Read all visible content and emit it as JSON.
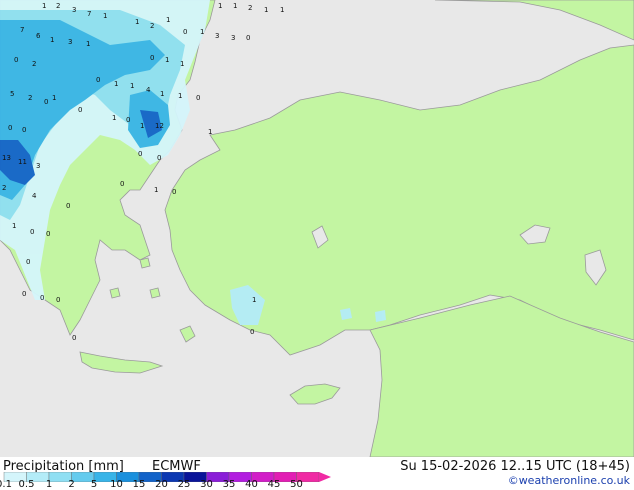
{
  "header": {
    "title": "Precipitation [mm]",
    "model": "ECMWF"
  },
  "timeline": "Su 15-02-2026 12..15 UTC (18+45)",
  "credit": "©weatheronline.co.uk",
  "colors": {
    "land": "#c3f5a2",
    "sea": "#e8e8e8",
    "border": "#9a9a9a"
  },
  "legend": {
    "ticks": [
      "0.1",
      "0.5",
      "1",
      "2",
      "5",
      "10",
      "15",
      "20",
      "25",
      "30",
      "35",
      "40",
      "45",
      "50"
    ],
    "colors": [
      "#d4f5fb",
      "#b4ecf8",
      "#8fdff3",
      "#64cbee",
      "#38b4e8",
      "#1a90dd",
      "#1263c9",
      "#0c38b2",
      "#0a1499",
      "#8a1ed8",
      "#b21de0",
      "#d21ec8",
      "#e21eb4",
      "#f02aa4"
    ]
  },
  "map_labels": [
    "1",
    "2",
    "3",
    "7",
    "1",
    "1",
    "1",
    "2",
    "1",
    "1",
    "7",
    "6",
    "1",
    "1",
    "2",
    "1",
    "1",
    "3",
    "3",
    "0",
    "0",
    "3",
    "2",
    "1",
    "0",
    "0",
    "1",
    "1",
    "5",
    "2",
    "0",
    "1",
    "0",
    "1",
    "1",
    "4",
    "1",
    "1",
    "0",
    "0",
    "1",
    "0",
    "12",
    "1",
    "0",
    "0",
    "13",
    "11",
    "3",
    "1",
    "0",
    "2",
    "0",
    "4",
    "1",
    "0",
    "0",
    "0",
    "0",
    "0",
    "0",
    "0",
    "1",
    "0",
    "0",
    "0",
    "1",
    "0"
  ]
}
